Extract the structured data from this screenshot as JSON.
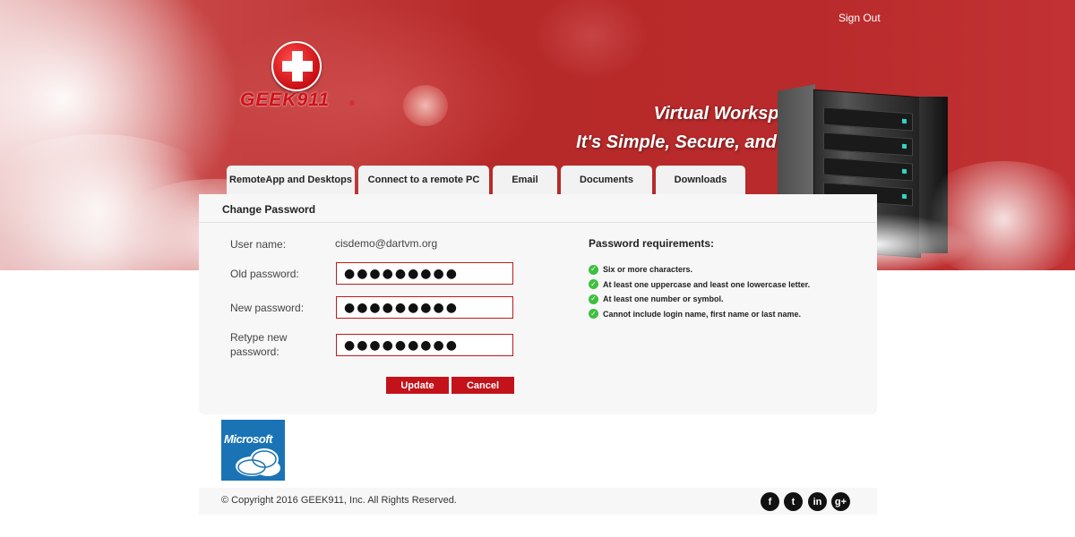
{
  "header": {
    "sign_out": "Sign Out",
    "logo_text": "GEEK911",
    "logo_reg": "®",
    "tagline_line1": "Virtual Workspace",
    "tagline_line2": "It's Simple, Secure, and Affordable!"
  },
  "tabs": [
    {
      "label": "RemoteApp and Desktops"
    },
    {
      "label": "Connect to a remote PC"
    },
    {
      "label": "Email"
    },
    {
      "label": "Documents"
    },
    {
      "label": "Downloads"
    }
  ],
  "panel": {
    "title": "Change Password",
    "form": {
      "username_label": "User name:",
      "username_value": "cisdemo@dartvm.org",
      "old_password_label": "Old password:",
      "old_password_value": "●●●●●●●●●",
      "new_password_label": "New password:",
      "new_password_value": "●●●●●●●●●",
      "retype_label_line1": "Retype new",
      "retype_label_line2": "password:",
      "retype_value": "●●●●●●●●●",
      "update_button": "Update",
      "cancel_button": "Cancel"
    },
    "requirements": {
      "title": "Password requirements:",
      "items": [
        "Six or more characters.",
        "At least one uppercase and least one lowercase letter.",
        "At least one number or symbol.",
        "Cannot include login name, first name or last name."
      ]
    }
  },
  "partner": {
    "name": "Microsoft"
  },
  "footer": {
    "copyright": "© Copyright 2016 GEEK911, Inc. All Rights Reserved.",
    "social": {
      "facebook": "f",
      "twitter": "t",
      "linkedin": "in",
      "googleplus": "g+"
    }
  },
  "colors": {
    "brand_red": "#c4121a",
    "banner_red": "#b72a2a",
    "check_green": "#3fbf3f",
    "ms_blue": "#1a73b5"
  }
}
